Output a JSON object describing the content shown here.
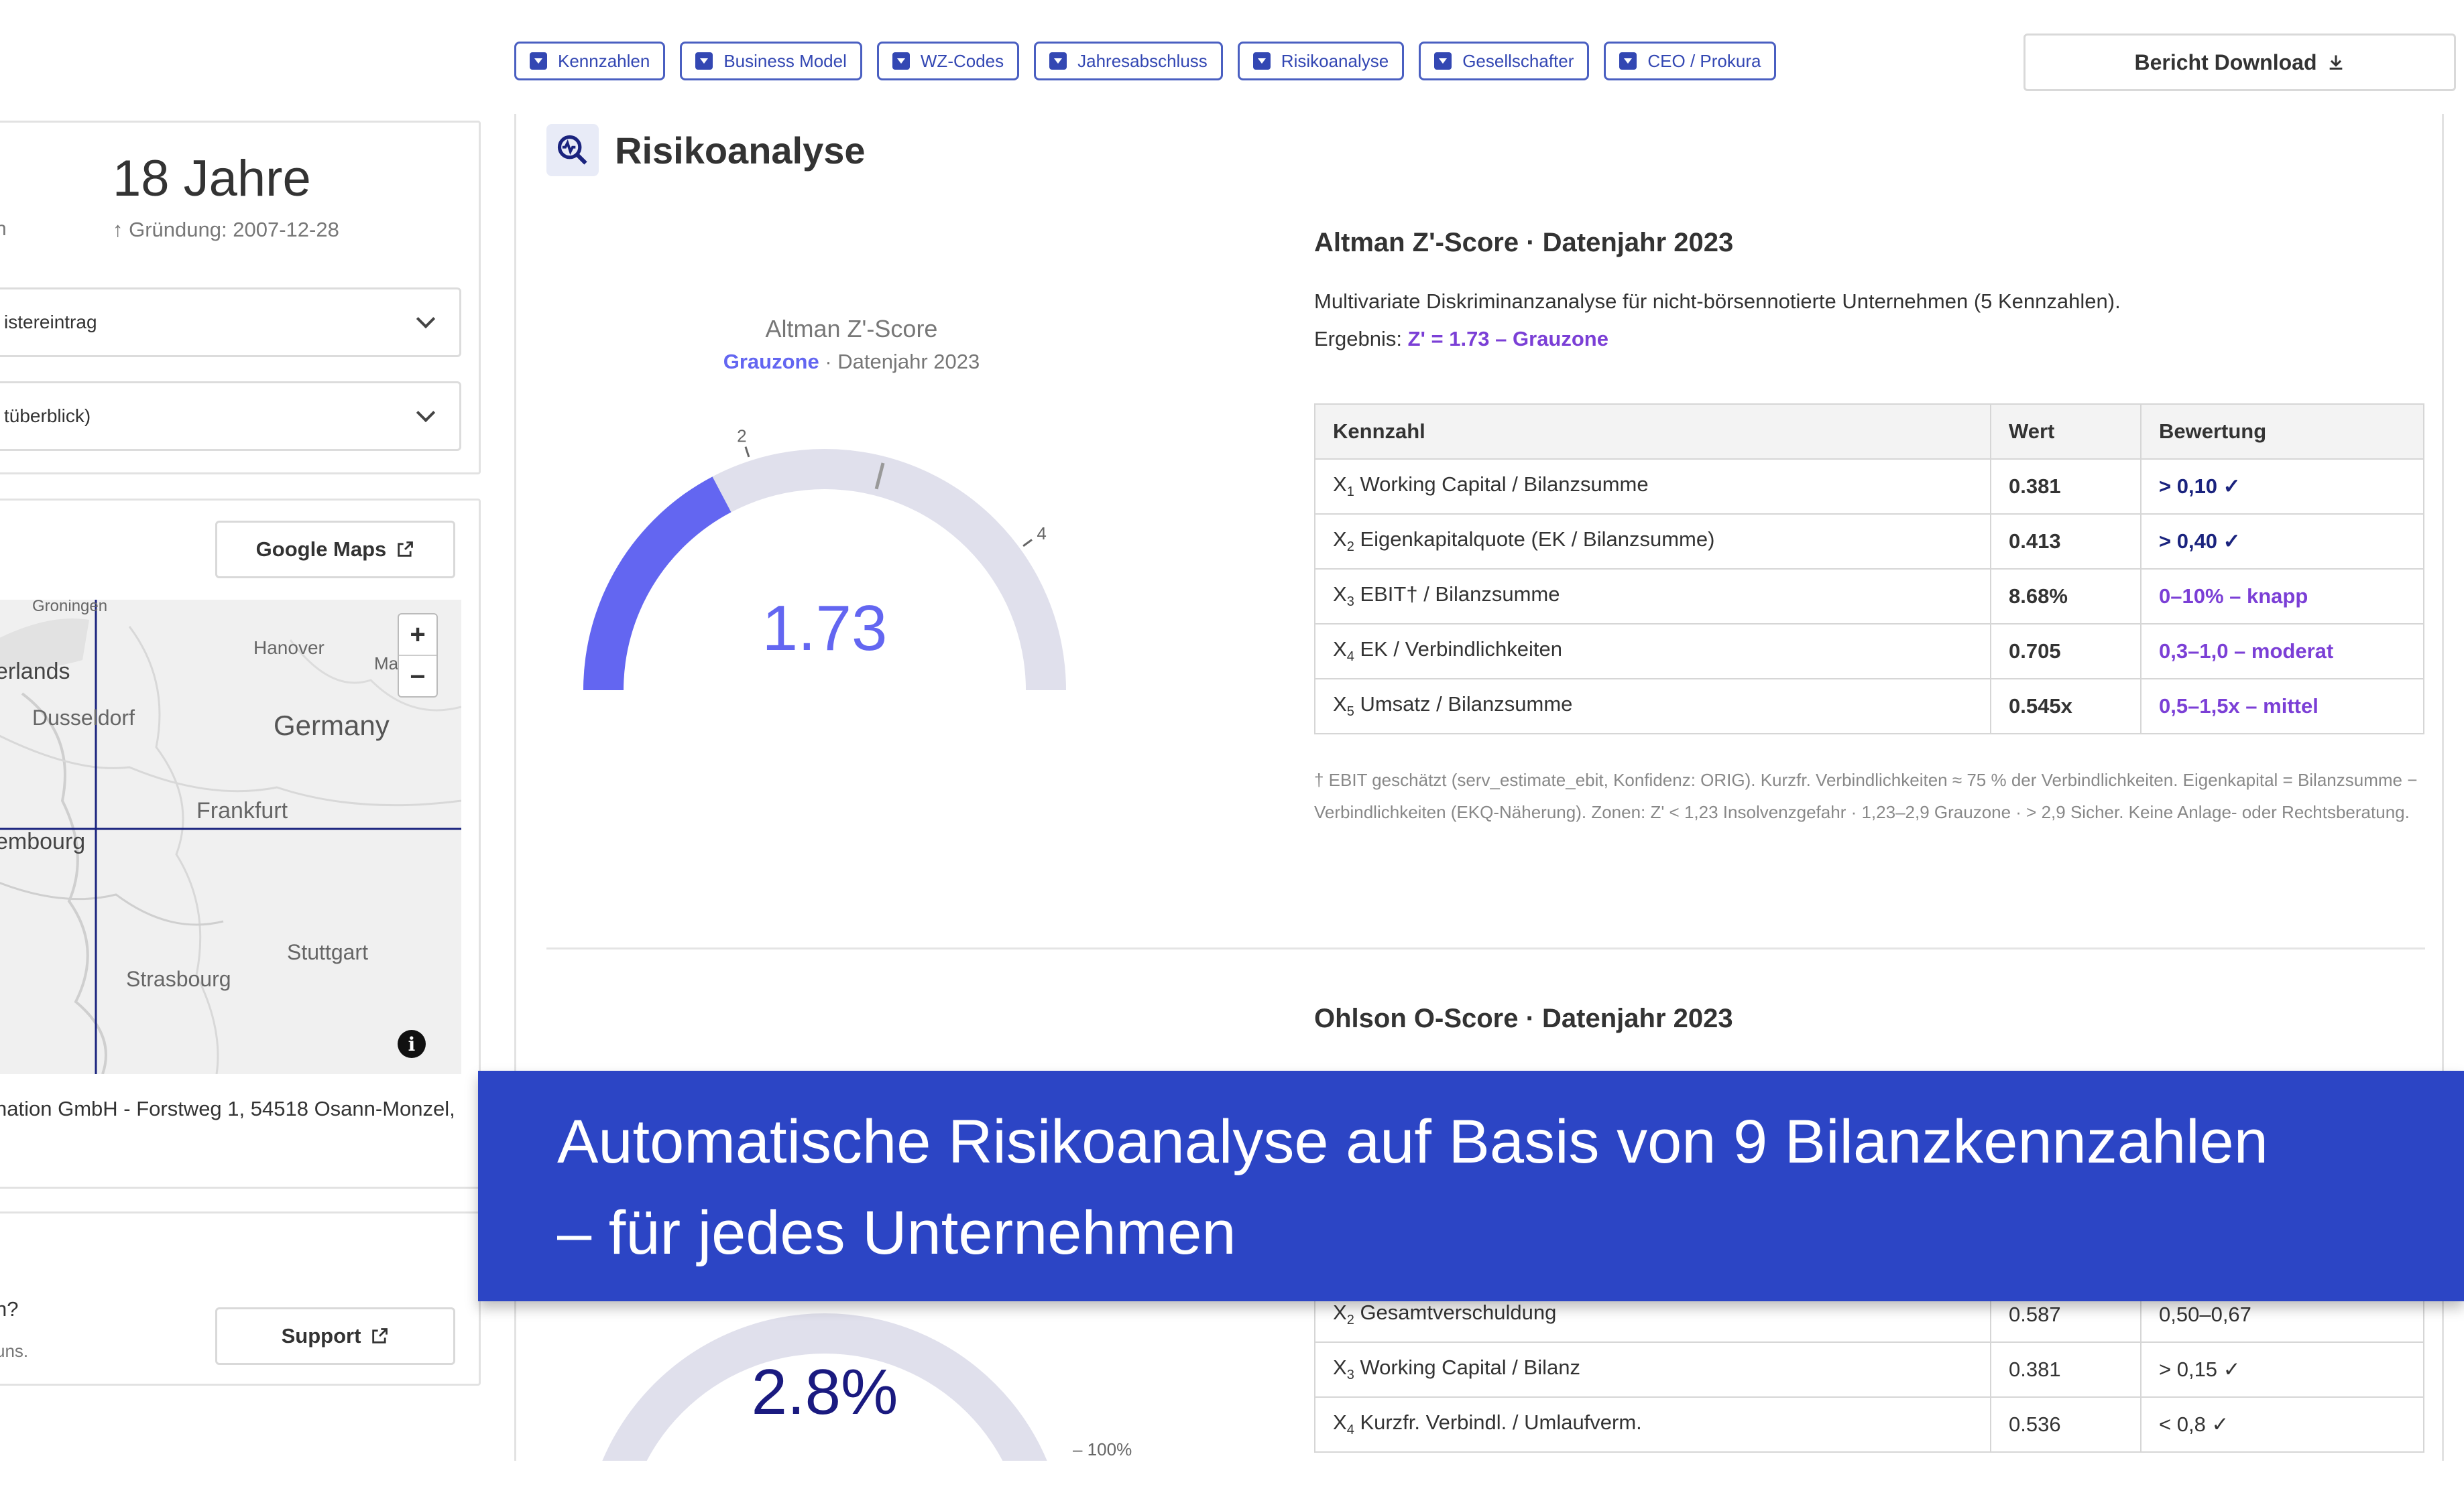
{
  "nav": {
    "items": [
      "Kennzahlen",
      "Business Model",
      "WZ-Codes",
      "Jahresabschluss",
      "Risikoanalyse",
      "Gesellschafter",
      "CEO / Prokura"
    ],
    "download_label": "Bericht Download"
  },
  "left": {
    "age": "18 Jahre",
    "age_sub_left": "n",
    "founding": "Gründung: 2007-12-28",
    "accordion1": "istereintrag",
    "accordion2": "tüberblick)",
    "maps_button": "Google Maps",
    "map_labels": [
      "Groningen",
      "Hanover",
      "Ma",
      "erlands",
      "Dusseldorf",
      "Germany",
      "Frankfurt",
      "embourg",
      "Stuttgart",
      "Strasbourg"
    ],
    "address": "nation GmbH - Forstweg 1, 54518 Osann-Monzel,",
    "question": "n?",
    "question_sub": "uns.",
    "support_button": "Support"
  },
  "section": {
    "title": "Risikoanalyse"
  },
  "altman": {
    "gauge_title": "Altman Z'-Score",
    "gauge_zone": "Grauzone",
    "gauge_year": " · Datenjahr 2023",
    "value": "1.73",
    "value_num": 1.73,
    "axis_max": 5,
    "ticks": [
      "0",
      "2",
      "4"
    ],
    "heading": "Altman Z'-Score · Datenjahr 2023",
    "description": "Multivariate Diskriminanzanalyse für nicht-börsennotierte Unternehmen (5 Kennzahlen).",
    "result_prefix": "Ergebnis: ",
    "result": "Z' = 1.73 – Grauzone",
    "table_headers": [
      "Kennzahl",
      "Wert",
      "Bewertung"
    ],
    "rows": [
      {
        "sub": "1",
        "name": "Working Capital / Bilanzsumme",
        "value": "0.381",
        "rating": "> 0,10 ✓",
        "status": "ok"
      },
      {
        "sub": "2",
        "name": "Eigenkapitalquote (EK / Bilanzsumme)",
        "value": "0.413",
        "rating": "> 0,40 ✓",
        "status": "ok"
      },
      {
        "sub": "3",
        "name": "EBIT† / Bilanzsumme",
        "value": "8.68%",
        "rating": "0–10% – knapp",
        "status": "warn"
      },
      {
        "sub": "4",
        "name": "EK / Verbindlichkeiten",
        "value": "0.705",
        "rating": "0,3–1,0 – moderat",
        "status": "warn"
      },
      {
        "sub": "5",
        "name": "Umsatz / Bilanzsumme",
        "value": "0.545x",
        "rating": "0,5–1,5x – mittel",
        "status": "warn"
      }
    ],
    "footnote": "† EBIT geschätzt (serv_estimate_ebit, Konfidenz: ORIG). Kurzfr. Verbindlichkeiten ≈ 75 % der Verbindlichkeiten. Eigenkapital = Bilanzsumme − Verbindlichkeiten (EKQ-Näherung). Zonen: Z' < 1,23 Insolvenzgefahr · 1,23–2,9 Grauzone · > 2,9 Sicher. Keine Anlage- oder Rechtsberatung."
  },
  "ohlson": {
    "heading": "Ohlson O-Score · Datenjahr 2023",
    "value": "2.8%",
    "value_num": 2.8,
    "tick_min": "0%",
    "tick_max": "100%",
    "rows": [
      {
        "sub": "2",
        "name": "Gesamtverschuldung",
        "value": "0.587",
        "rating": "0,50–0,67",
        "status": "warn"
      },
      {
        "sub": "3",
        "name": "Working Capital / Bilanz",
        "value": "0.381",
        "rating": "> 0,15 ✓",
        "status": "ok"
      },
      {
        "sub": "4",
        "name": "Kurzfr. Verbindl. / Umlaufverm.",
        "value": "0.536",
        "rating": "< 0,8 ✓",
        "status": "ok"
      }
    ]
  },
  "banner": {
    "line1": "Automatische Risikoanalyse auf Basis von 9 Bilanzkennzahlen",
    "line2": "– für jedes Unternehmen"
  },
  "colors": {
    "accent": "#3347b3",
    "gauge_fill": "#6366f1",
    "gauge_track": "#e0e0ec",
    "ohlson_fill": "#1a1a80",
    "banner": "#2c45c5"
  }
}
